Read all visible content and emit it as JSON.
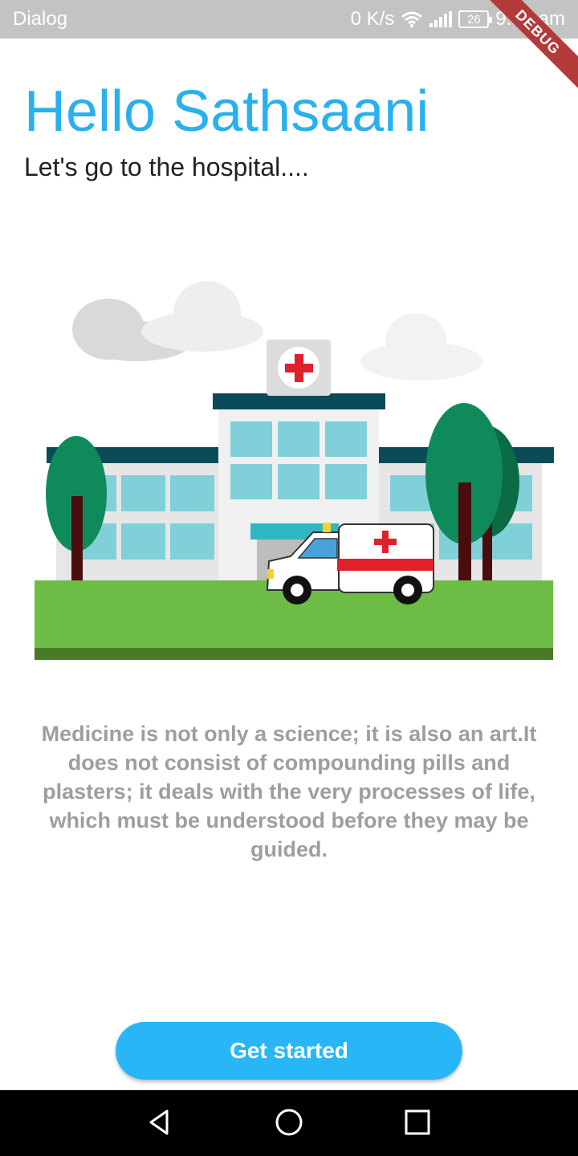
{
  "status_bar": {
    "app_label": "Dialog",
    "network_speed": "0 K/s",
    "battery_level": "26",
    "time": "9:56 am",
    "icons": [
      "wifi-icon",
      "signal-icon",
      "battery-icon"
    ]
  },
  "debug_banner": {
    "label": "DEBUG"
  },
  "header": {
    "greeting": "Hello Sathsaani",
    "subtitle": "Let's go to the hospital...."
  },
  "illustration": {
    "icon": "hospital-ambulance-illustration"
  },
  "quote": {
    "text": "Medicine is not only a science; it is also an art.It does not consist of compounding pills and plasters; it deals with the very processes of life, which must be understood before they may be guided."
  },
  "cta": {
    "label": "Get started"
  },
  "nav_bar": {
    "icons": [
      "back-icon",
      "home-icon",
      "recent-apps-icon"
    ]
  },
  "colors": {
    "accent": "#29b0ee",
    "button": "#29b6f6",
    "quote_text": "#9e9e9e",
    "status_bar": "#c3c3c3"
  }
}
